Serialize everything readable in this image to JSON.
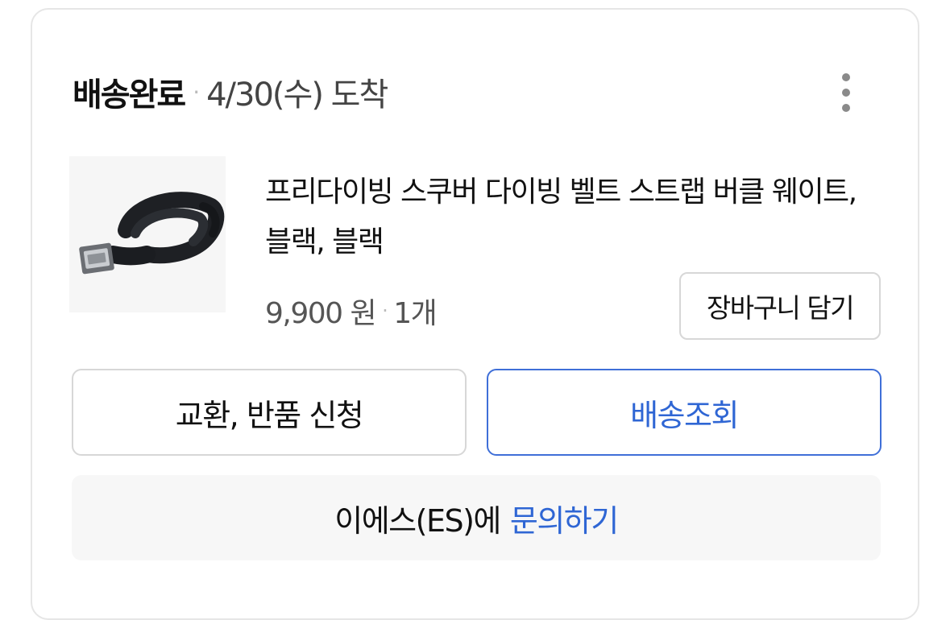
{
  "order": {
    "status": "배송완료",
    "separator": "·",
    "arrival": "4/30(수) 도착"
  },
  "menu": {
    "icon": "more-vertical-icon"
  },
  "product": {
    "image": "black-diving-belt-image",
    "name": "프리다이빙 스쿠버 다이빙 벨트 스트랩 버클 웨이트, 블랙, 블랙",
    "price": "9,900 원",
    "separator": "·",
    "quantity": "1개",
    "cart_button": "장바구니 담기"
  },
  "actions": {
    "return_label": "교환, 반품 신청",
    "track_label": "배송조회"
  },
  "inquiry": {
    "seller_text": "이에스(ES)에",
    "link_text": "문의하기"
  },
  "colors": {
    "accent": "#2f66d4",
    "border": "#d7d7d7",
    "inquiry_bg": "#f7f7f7"
  }
}
